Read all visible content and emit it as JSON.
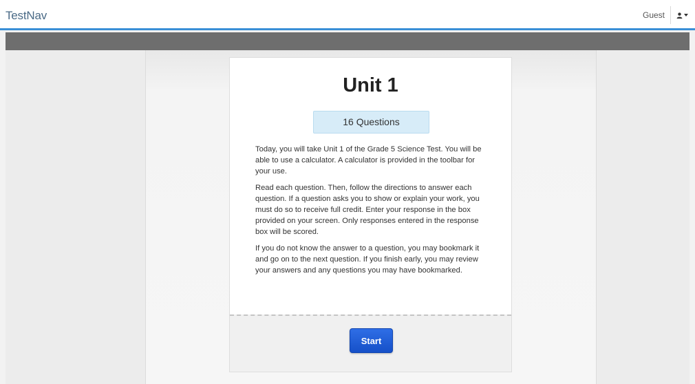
{
  "header": {
    "brand": "TestNav",
    "user_name": "Guest",
    "user_menu_icon": "user-icon",
    "user_menu_caret": "caret-down-icon",
    "accent_color": "#3a8fd6"
  },
  "card": {
    "title": "Unit 1",
    "question_count": "16 Questions",
    "paragraphs": [
      "Today, you will take Unit 1 of the Grade 5 Science Test. You will be able to use a calculator. A calculator is provided in the toolbar for your use.",
      "Read each question. Then, follow the directions to answer each question. If a question asks you to show or explain your work, you must do so to receive full credit. Enter your response in the box provided on your screen. Only responses entered in the response box will be scored.",
      "If you do not know the answer to a question, you may bookmark it and go on to the next question. If you finish early, you may review your answers and any questions you may have bookmarked."
    ],
    "start_label": "Start",
    "start_color": "#1f5fd8"
  }
}
